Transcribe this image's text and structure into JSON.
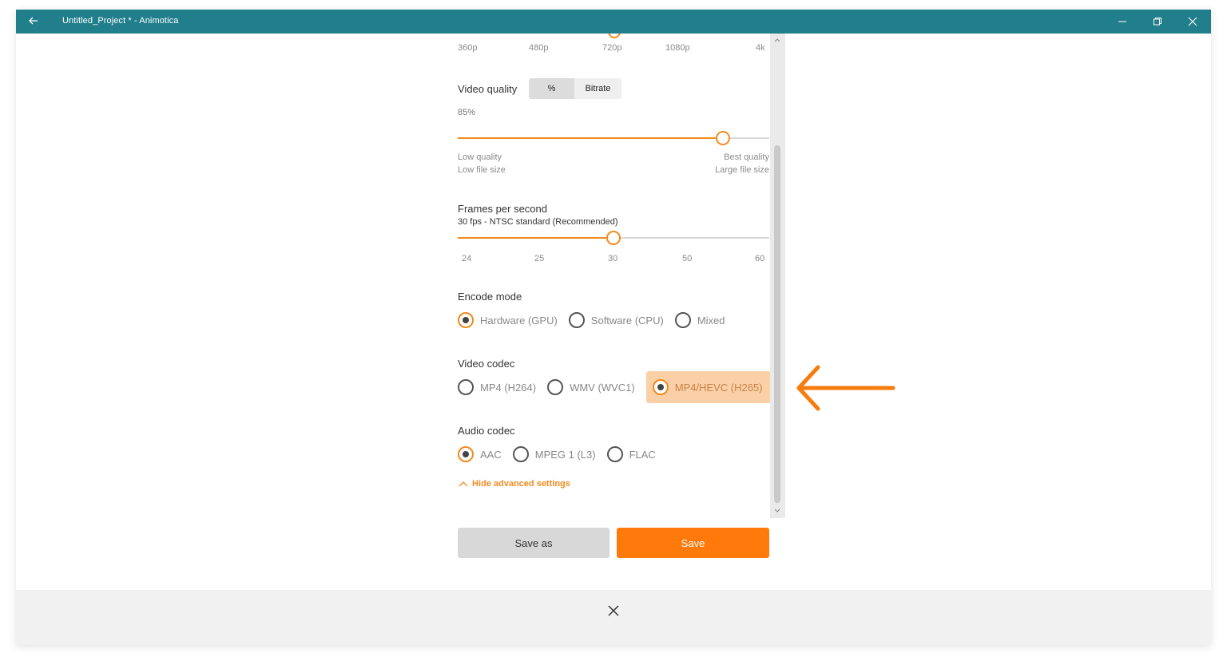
{
  "window": {
    "title": "Untitled_Project * - Animotica",
    "accent": "#217f8c",
    "orange": "#f58a1f"
  },
  "resolution": {
    "ticks": [
      "360p",
      "480p",
      "720p",
      "1080p",
      "4k"
    ],
    "selected": "720p"
  },
  "video_quality": {
    "label": "Video quality",
    "modes": [
      "%",
      "Bitrate"
    ],
    "selected_mode": "%",
    "value_text": "85%",
    "value": 0.85,
    "low_line1": "Low quality",
    "low_line2": "Low file size",
    "high_line1": "Best quality",
    "high_line2": "Large file size"
  },
  "fps": {
    "label": "Frames per second",
    "value_text": "30 fps - NTSC standard (Recommended)",
    "ticks": [
      "24",
      "25",
      "30",
      "50",
      "60"
    ],
    "selected": "30"
  },
  "encode_mode": {
    "label": "Encode mode",
    "options": [
      "Hardware (GPU)",
      "Software (CPU)",
      "Mixed"
    ],
    "selected": "Hardware (GPU)"
  },
  "video_codec": {
    "label": "Video codec",
    "options": [
      "MP4 (H264)",
      "WMV (WVC1)",
      "MP4/HEVC (H265)"
    ],
    "selected": "MP4/HEVC (H265)"
  },
  "audio_codec": {
    "label": "Audio codec",
    "options": [
      "AAC",
      "MPEG 1 (L3)",
      "FLAC"
    ],
    "selected": "AAC"
  },
  "advanced": {
    "toggle_label": "Hide advanced settings"
  },
  "actions": {
    "save_as": "Save as",
    "save": "Save"
  }
}
